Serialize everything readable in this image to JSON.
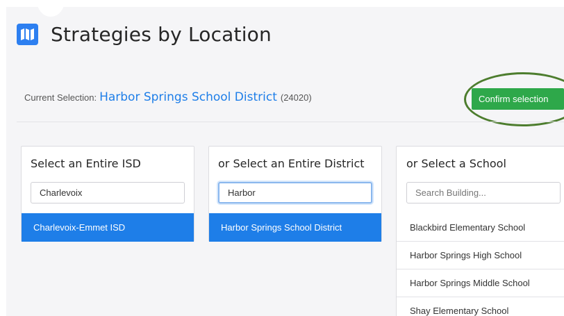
{
  "header": {
    "title": "Strategies by Location",
    "icon": "map-icon",
    "icon_color": "#2d7ff0"
  },
  "selection": {
    "label": "Current Selection:",
    "value": "Harbor Springs School District",
    "code": "(24020)",
    "confirm_label": "Confirm selection"
  },
  "colors": {
    "accent": "#1e7ee8",
    "confirm": "#2ea84a",
    "annotation": "#4d7d2e"
  },
  "isd_panel": {
    "title": "Select an Entire ISD",
    "search_value": "Charlevoix",
    "results": [
      "Charlevoix-Emmet ISD"
    ]
  },
  "district_panel": {
    "title": "or Select an Entire District",
    "search_value": "Harbor",
    "results": [
      "Harbor Springs School District"
    ]
  },
  "school_panel": {
    "title": "or Select a School",
    "search_placeholder": "Search Building...",
    "search_value": "",
    "results": [
      "Blackbird Elementary School",
      "Harbor Springs High School",
      "Harbor Springs Middle School",
      "Shay Elementary School"
    ]
  }
}
